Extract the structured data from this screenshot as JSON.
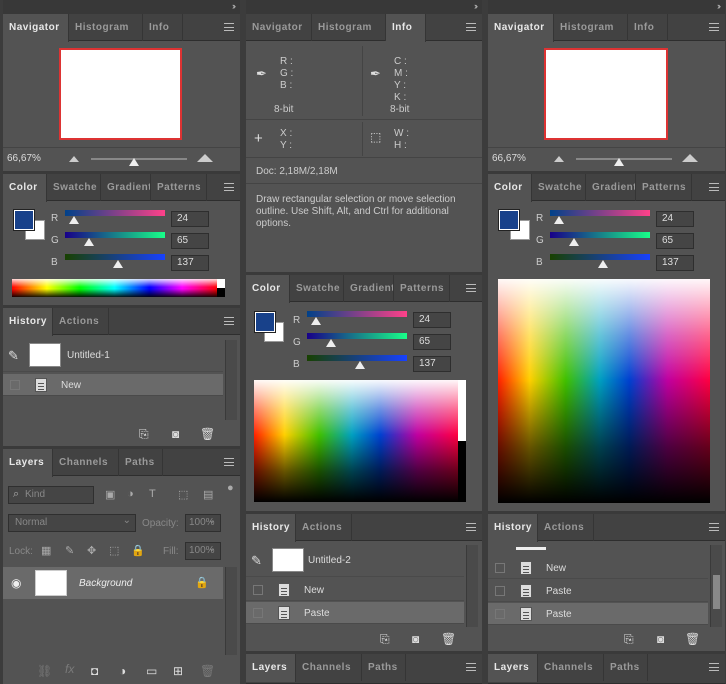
{
  "col1": {
    "tabs1": [
      "Navigator",
      "Histogram",
      "Info"
    ],
    "zoom": "66,67%",
    "tabs2": [
      "Color",
      "Swatche",
      "Gradient",
      "Patterns"
    ],
    "channels": [
      {
        "label": "R",
        "value": "24"
      },
      {
        "label": "G",
        "value": "65"
      },
      {
        "label": "B",
        "value": "137"
      }
    ],
    "history_tabs": [
      "History",
      "Actions"
    ],
    "history_snapshot": "Untitled-1",
    "history_items": [
      "New"
    ],
    "layers_tabs": [
      "Layers",
      "Channels",
      "Paths"
    ],
    "kind_label": "Kind",
    "blend_mode": "Normal",
    "opacity_label": "Opacity:",
    "opacity_value": "100%",
    "lock_label": "Lock:",
    "fill_label": "Fill:",
    "fill_value": "100%",
    "layer_name": "Background"
  },
  "col2": {
    "tabs1": [
      "Navigator",
      "Histogram",
      "Info"
    ],
    "info_rgb_labels": [
      "R :",
      "G :",
      "B :"
    ],
    "info_cmyk_labels": [
      "C :",
      "M :",
      "Y :",
      "K :"
    ],
    "bit_left": "8-bit",
    "bit_right": "8-bit",
    "xy_labels": [
      "X :",
      "Y :"
    ],
    "wh_labels": [
      "W :",
      "H :"
    ],
    "doc": "Doc: 2,18M/2,18M",
    "hint": "Draw rectangular selection or move selection outline.  Use Shift, Alt, and Ctrl for additional options.",
    "tabs2": [
      "Color",
      "Swatche",
      "Gradient",
      "Patterns"
    ],
    "channels": [
      {
        "label": "R",
        "value": "24"
      },
      {
        "label": "G",
        "value": "65"
      },
      {
        "label": "B",
        "value": "137"
      }
    ],
    "history_tabs": [
      "History",
      "Actions"
    ],
    "history_snapshot": "Untitled-2",
    "history_items": [
      "New",
      "Paste"
    ],
    "layers_tabs": [
      "Layers",
      "Channels",
      "Paths"
    ]
  },
  "col3": {
    "tabs1": [
      "Navigator",
      "Histogram",
      "Info"
    ],
    "zoom": "66,67%",
    "tabs2": [
      "Color",
      "Swatche",
      "Gradient",
      "Patterns"
    ],
    "channels": [
      {
        "label": "R",
        "value": "24"
      },
      {
        "label": "G",
        "value": "65"
      },
      {
        "label": "B",
        "value": "137"
      }
    ],
    "history_tabs": [
      "History",
      "Actions"
    ],
    "history_items": [
      "New",
      "Paste",
      "Paste"
    ],
    "layers_tabs": [
      "Layers",
      "Channels",
      "Paths"
    ]
  },
  "colors": {
    "foreground": "#18418a",
    "background": "#ffffff",
    "panel": "#535353",
    "tab_bar": "#424242",
    "selected_row": "#6a6a6a",
    "navigator_border": "#dd3333"
  }
}
